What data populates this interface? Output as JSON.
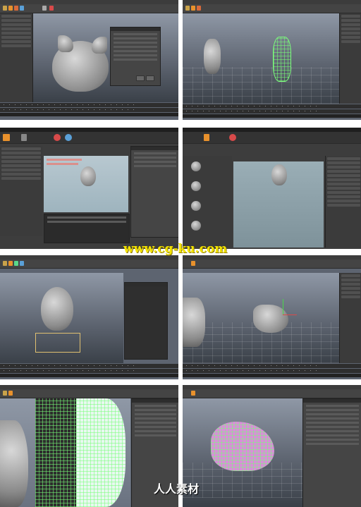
{
  "watermark": {
    "top_text": "www.cg-ku.com",
    "bottom_text": "人人素材"
  },
  "panels": [
    {
      "id": "p1",
      "description_label": ""
    },
    {
      "id": "p2",
      "description_label": ""
    },
    {
      "id": "p3",
      "description_label": ""
    },
    {
      "id": "p4",
      "description_label": ""
    },
    {
      "id": "p5",
      "description_label": ""
    },
    {
      "id": "p6",
      "description_label": ""
    },
    {
      "id": "p7",
      "description_label": ""
    },
    {
      "id": "p8",
      "description_label": ""
    }
  ],
  "colors": {
    "viewport_top": "#8f98a6",
    "viewport_bottom": "#3a4048",
    "ui_dark": "#3b3b3b",
    "accent_orange": "#e8912c",
    "wire_green": "#7cff7c",
    "wire_magenta": "#d88fd8",
    "watermark_yellow": "#f4e400"
  },
  "icons": [
    "move-icon",
    "rotate-icon",
    "scale-icon",
    "select-icon",
    "render-icon",
    "sphere-icon"
  ]
}
